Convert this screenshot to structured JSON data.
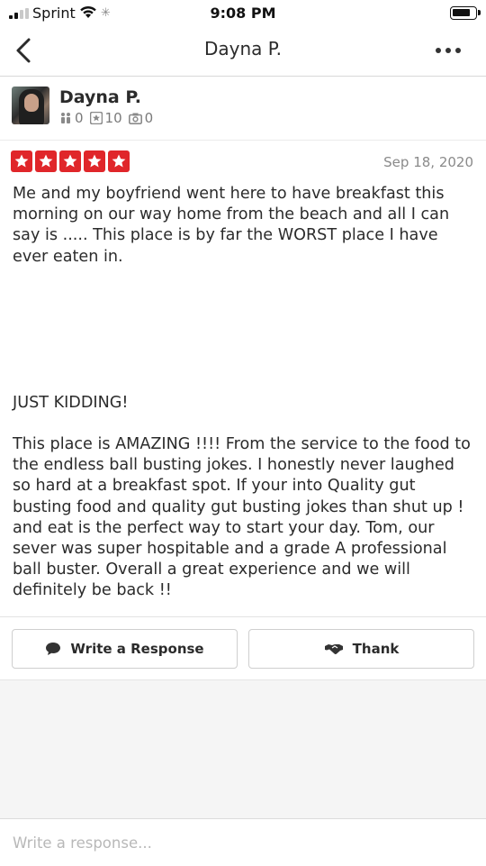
{
  "status_bar": {
    "carrier": "Sprint",
    "time": "9:08 PM"
  },
  "nav": {
    "title": "Dayna P.",
    "back_icon": "chevron-left-icon",
    "more_icon": "more-horizontal-icon"
  },
  "user": {
    "name": "Dayna P.",
    "friends_count": "0",
    "reviews_count": "10",
    "photos_count": "0"
  },
  "review": {
    "rating": 5,
    "rating_color": "#e0262a",
    "date": "Sep 18, 2020",
    "paragraphs": [
      "Me and my boyfriend went here to have breakfast this morning on our way home from the beach and all I can say is ..... This place is by far the WORST place I have ever eaten in.",
      "JUST KIDDING!",
      "This place is AMAZING !!!! From the service to the food to the endless ball busting jokes. I honestly never laughed so hard at a breakfast spot. If your into Quality gut busting food and quality gut busting jokes than shut up ! and eat is the perfect way to start your day. Tom, our sever was super hospitable and a grade A professional ball buster. Overall a great experience and we will definitely be back !!"
    ]
  },
  "actions": {
    "write_response_label": "Write a Response",
    "thank_label": "Thank"
  },
  "composer": {
    "placeholder": "Write a response..."
  }
}
